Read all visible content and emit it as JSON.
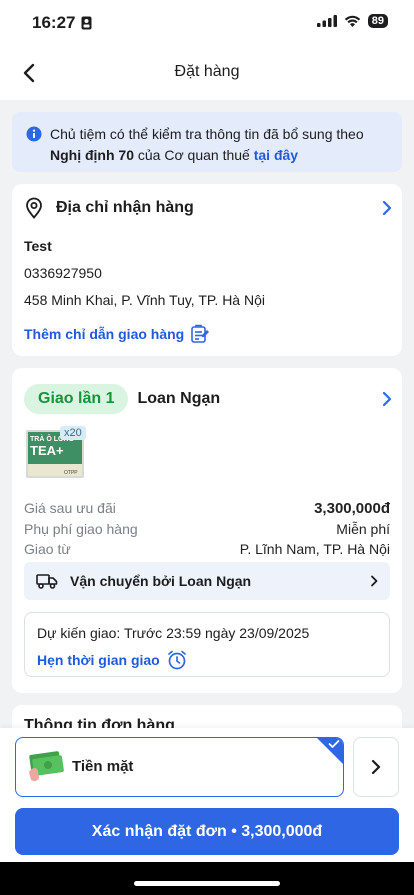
{
  "status_bar": {
    "time": "16:27",
    "battery": "89"
  },
  "header": {
    "title": "Đặt hàng"
  },
  "info_banner": {
    "text_1": "Chủ tiệm có thể kiểm tra thông tin đã bổ sung theo ",
    "bold": "Nghị định 70",
    "text_2": " của Cơ quan thuế ",
    "link": "tại đây"
  },
  "address": {
    "title": "Địa chỉ nhận hàng",
    "name": "Test",
    "phone": "0336927950",
    "address_line": "458 Minh Khai, P. Vĩnh Tuy, TP. Hà Nội",
    "add_note_label": "Thêm chỉ dẫn giao hàng"
  },
  "shipment": {
    "badge": "Giao lần 1",
    "shop_name": "Loan Ngạn",
    "product": {
      "quantity": "x20",
      "brand_small": "TRÀ Ô LONG",
      "brand_big": "TEA+",
      "pack_mark": "OTPP"
    },
    "rows": [
      {
        "label": "Giá sau ưu đãi",
        "value": "3,300,000đ"
      },
      {
        "label": "Phụ phí giao hàng",
        "value": "Miễn phí"
      },
      {
        "label": "Giao từ",
        "value": "P. Lĩnh Nam, TP. Hà Nội"
      }
    ],
    "carrier_label": "Vận chuyển bởi Loan Ngạn",
    "eta": "Dự kiến giao: Trước 23:59 ngày 23/09/2025",
    "schedule_label": "Hẹn thời gian giao"
  },
  "order_info": {
    "title": "Thông tin đơn hàng"
  },
  "payment": {
    "method": "Tiền mặt"
  },
  "confirm": {
    "label": "Xác nhận đặt đơn • 3,300,000đ"
  },
  "colors": {
    "accent": "#2f66e4",
    "badge_bg": "#d9f5e1",
    "badge_text": "#17923d"
  }
}
